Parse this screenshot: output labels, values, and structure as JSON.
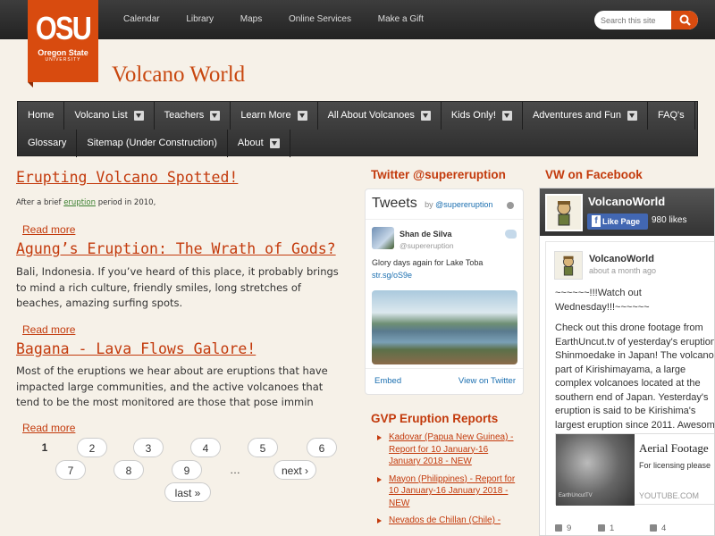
{
  "header": {
    "logo": {
      "big": "OSU",
      "line1": "Oregon State",
      "line2": "UNIVERSITY"
    },
    "links": [
      "Calendar",
      "Library",
      "Maps",
      "Online Services",
      "Make a Gift"
    ],
    "search_placeholder": "Search this site",
    "site_title": "Volcano World"
  },
  "nav": {
    "row1": [
      {
        "label": "Home",
        "dropdown": false
      },
      {
        "label": "Volcano List",
        "dropdown": true
      },
      {
        "label": "Teachers",
        "dropdown": true
      },
      {
        "label": "Learn More",
        "dropdown": true
      },
      {
        "label": "All About Volcanoes",
        "dropdown": true
      },
      {
        "label": "Kids Only!",
        "dropdown": true
      },
      {
        "label": "Adventures and Fun",
        "dropdown": true
      },
      {
        "label": "FAQ's",
        "dropdown": false
      }
    ],
    "row2": [
      {
        "label": "Glossary",
        "dropdown": false
      },
      {
        "label": "Sitemap (Under Construction)",
        "dropdown": false
      },
      {
        "label": "About",
        "dropdown": true
      }
    ]
  },
  "posts": [
    {
      "title": "Erupting Volcano Spotted!",
      "body_pre": "After a brief ",
      "body_tag": "eruption",
      "body_post": " period in 2010,",
      "more": "Read more"
    },
    {
      "title": "Agung’s Eruption: The Wrath of Gods?",
      "body": "Bali, Indonesia. If you’ve heard of this place, it probably brings to mind a rich culture, friendly smiles, long stretches of beaches, amazing surfing spots.",
      "more": "Read more"
    },
    {
      "title": "Bagana - Lava Flows Galore!",
      "body": "Most of the eruptions we hear about are eruptions that have impacted large communities, and the active volcanoes that tend to be the most monitored are those that pose immin",
      "more": "Read more"
    }
  ],
  "pager": {
    "current": "1",
    "pages": [
      "2",
      "3",
      "4",
      "5",
      "6",
      "7",
      "8",
      "9"
    ],
    "ellipsis": "…",
    "next": "next ›",
    "last": "last »"
  },
  "twitter": {
    "heading": "Twitter @supereruption",
    "widget_title": "Tweets",
    "by": "by",
    "by_handle": "@supereruption",
    "tweet": {
      "name": "Shan de Silva",
      "handle": "@supereruption",
      "text": "Glory days again for Lake Toba",
      "link": "str.sg/oS9e"
    },
    "embed": "Embed",
    "view": "View on Twitter"
  },
  "gvp": {
    "heading": "GVP Eruption Reports",
    "items": [
      "Kadovar (Papua New Guinea) - Report for 10 January-16 January 2018 - NEW",
      "Mayon (Philippines) - Report for 10 January-16 January 2018 - NEW",
      "Nevados de Chillan (Chile) -"
    ]
  },
  "facebook": {
    "heading": "VW on Facebook",
    "page_name": "VolcanoWorld",
    "like_label": "Like Page",
    "likes": "980 likes",
    "post": {
      "name": "VolcanoWorld",
      "time": "about a month ago",
      "msg1": "~~~~~~!!!Watch out Wednesday!!!~~~~~~",
      "msg2": "Check out this drone footage from EarthUncut.tv of yesterday's eruption a Shinmoedake in Japan! The volcano is part of Kirishimayama, a large complex volcanoes located at the southern end of Japan. Yesterday's eruption is said to be Kirishima's largest eruption since 2011. Awesome!",
      "card_title": "Aerial Footage",
      "card_desc": "For licensing please",
      "card_url": "YOUTUBE.COM",
      "thumb_label": "EarthUncutTV",
      "likes": "9",
      "comments": "1",
      "shares": "4"
    }
  },
  "colors": {
    "accent": "#c33a0c",
    "logo": "#d84b0f",
    "nav": "#3a3a3a",
    "background": "#f6f1e8",
    "twitter_link": "#1b6fb0",
    "facebook": "#4267b2"
  }
}
